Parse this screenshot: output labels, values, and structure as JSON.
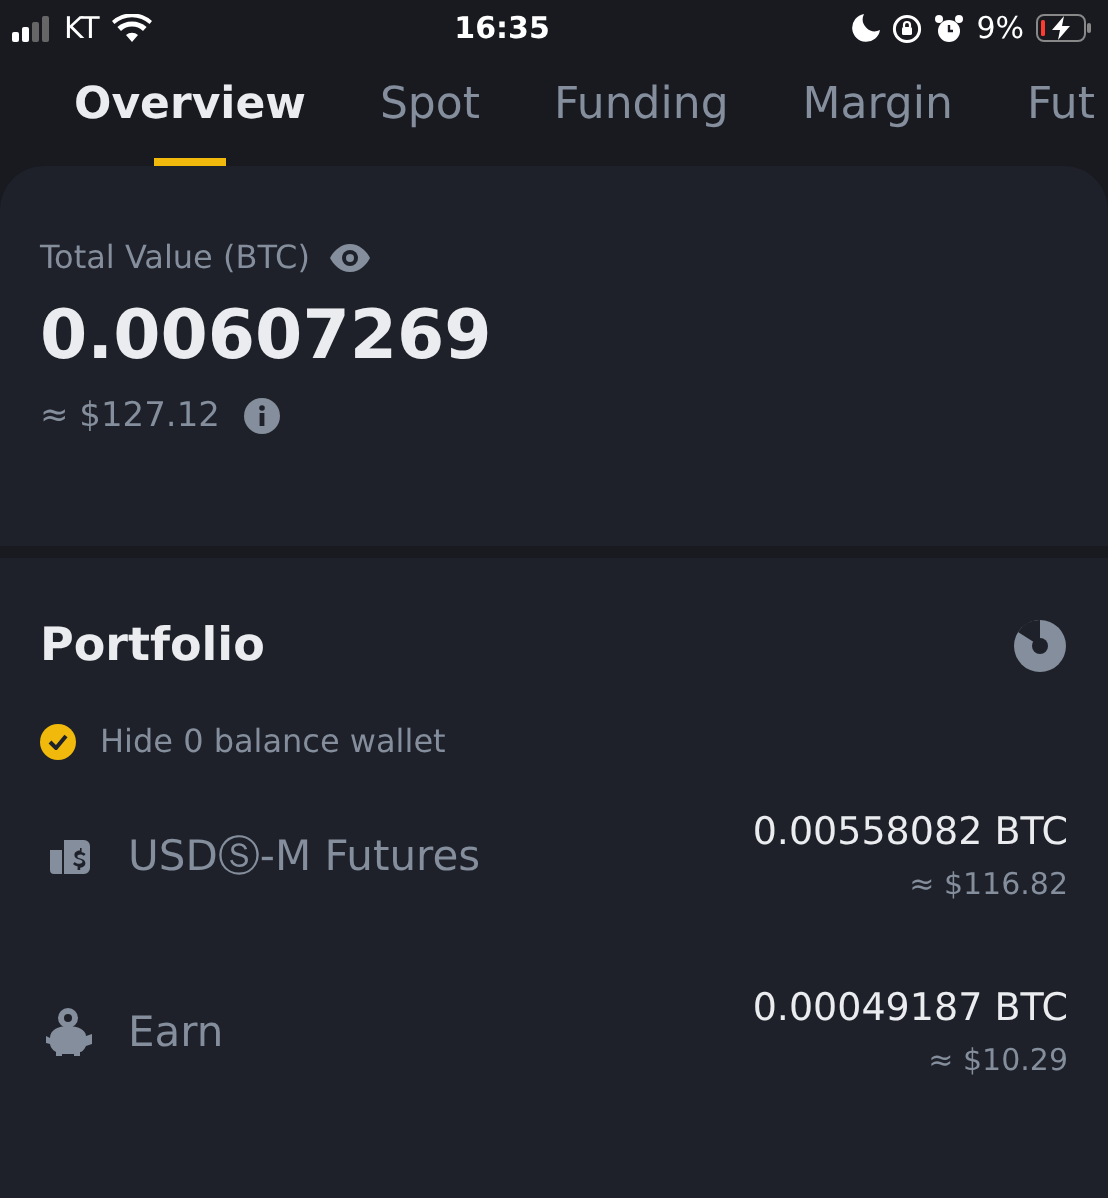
{
  "status_bar": {
    "carrier": "KT",
    "time": "16:35",
    "battery": "9%"
  },
  "tabs": [
    {
      "label": "Overview",
      "selected": true
    },
    {
      "label": "Spot",
      "selected": false
    },
    {
      "label": "Funding",
      "selected": false
    },
    {
      "label": "Margin",
      "selected": false
    },
    {
      "label": "Fut",
      "selected": false
    }
  ],
  "total": {
    "label": "Total Value (BTC)",
    "value": "0.00607269",
    "fiat": "≈ $127.12"
  },
  "portfolio": {
    "title": "Portfolio",
    "hide_zero": {
      "label": "Hide 0 balance wallet",
      "checked": true
    },
    "wallets": [
      {
        "kind": "futures",
        "name": "USDⓈ-M Futures",
        "amount": "0.00558082 BTC",
        "fiat": "≈ $116.82"
      },
      {
        "kind": "earn",
        "name": "Earn",
        "amount": "0.00049187 BTC",
        "fiat": "≈ $10.29"
      }
    ]
  }
}
